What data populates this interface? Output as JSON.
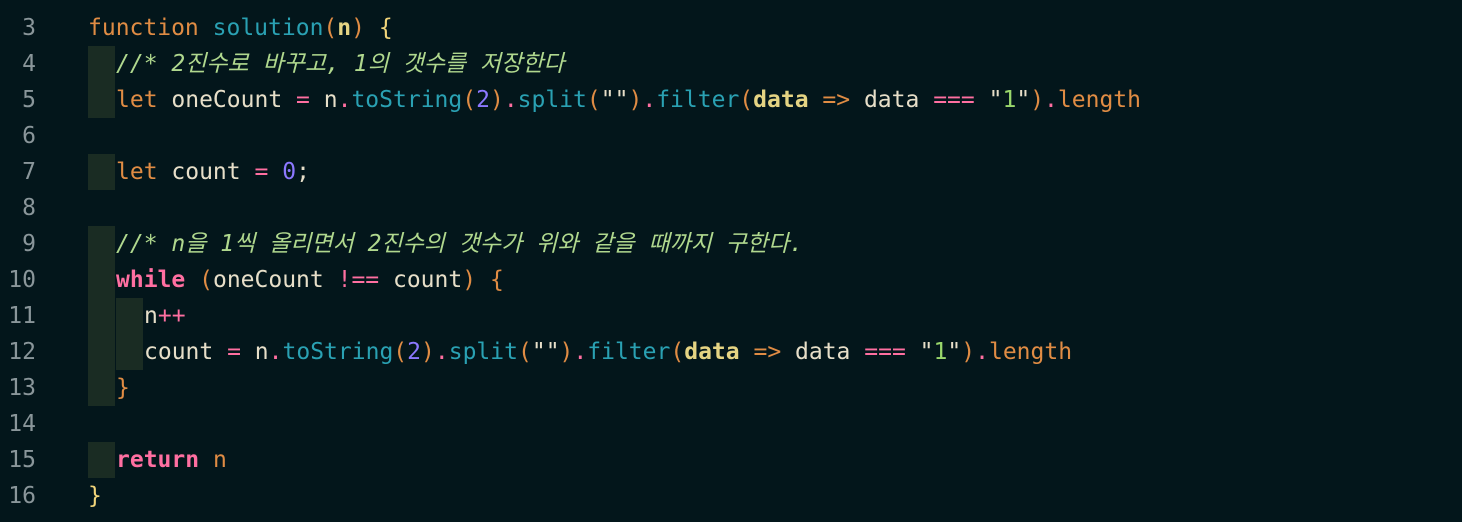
{
  "editor": {
    "colors": {
      "background": "#03161b",
      "line_number": "#8a969a",
      "keyword": "#e08c44",
      "function": "#2aa1b3",
      "comment": "#b0d88e",
      "operator": "#ff6fa1",
      "number": "#8c78ff",
      "string": "#9ad86c",
      "indent_guide": "#1a2c23"
    },
    "lines": [
      {
        "number": "3",
        "tokens": [
          {
            "t": "function",
            "c": "kw"
          },
          {
            "t": " ",
            "c": "plain"
          },
          {
            "t": "solution",
            "c": "fn"
          },
          {
            "t": "(",
            "c": "paren"
          },
          {
            "t": "n",
            "c": "param"
          },
          {
            "t": ")",
            "c": "paren"
          },
          {
            "t": " ",
            "c": "plain"
          },
          {
            "t": "{",
            "c": "brace"
          }
        ]
      },
      {
        "number": "4",
        "tokens": [
          {
            "t": "//* 2진수로 바꾸고, 1의 갯수를 저장한다",
            "c": "comment"
          }
        ]
      },
      {
        "number": "5",
        "tokens": [
          {
            "t": "let",
            "c": "kw"
          },
          {
            "t": " oneCount ",
            "c": "plain"
          },
          {
            "t": "=",
            "c": "op"
          },
          {
            "t": " n",
            "c": "plain"
          },
          {
            "t": ".",
            "c": "op"
          },
          {
            "t": "toString",
            "c": "method"
          },
          {
            "t": "(",
            "c": "paren"
          },
          {
            "t": "2",
            "c": "num"
          },
          {
            "t": ")",
            "c": "paren"
          },
          {
            "t": ".",
            "c": "op"
          },
          {
            "t": "split",
            "c": "method"
          },
          {
            "t": "(",
            "c": "paren"
          },
          {
            "t": "\"\"",
            "c": "plain"
          },
          {
            "t": ")",
            "c": "paren"
          },
          {
            "t": ".",
            "c": "op"
          },
          {
            "t": "filter",
            "c": "method"
          },
          {
            "t": "(",
            "c": "paren"
          },
          {
            "t": "data",
            "c": "param"
          },
          {
            "t": " ",
            "c": "plain"
          },
          {
            "t": "=>",
            "c": "kw"
          },
          {
            "t": " data ",
            "c": "plain"
          },
          {
            "t": "===",
            "c": "op"
          },
          {
            "t": " ",
            "c": "plain"
          },
          {
            "t": "\"",
            "c": "plain"
          },
          {
            "t": "1",
            "c": "str"
          },
          {
            "t": "\"",
            "c": "plain"
          },
          {
            "t": ")",
            "c": "paren"
          },
          {
            "t": ".",
            "c": "op"
          },
          {
            "t": "length",
            "c": "prop"
          }
        ]
      },
      {
        "number": "6",
        "tokens": []
      },
      {
        "number": "7",
        "tokens": [
          {
            "t": "let",
            "c": "kw"
          },
          {
            "t": " count ",
            "c": "plain"
          },
          {
            "t": "=",
            "c": "op"
          },
          {
            "t": " ",
            "c": "plain"
          },
          {
            "t": "0",
            "c": "num"
          },
          {
            "t": ";",
            "c": "plain"
          }
        ]
      },
      {
        "number": "8",
        "tokens": []
      },
      {
        "number": "9",
        "tokens": [
          {
            "t": "//* n을 1씩 올리면서 2진수의 갯수가 위와 같을 때까지 구한다.",
            "c": "comment"
          }
        ]
      },
      {
        "number": "10",
        "tokens": [
          {
            "t": "while",
            "c": "ctrl"
          },
          {
            "t": " ",
            "c": "plain"
          },
          {
            "t": "(",
            "c": "paren"
          },
          {
            "t": "oneCount ",
            "c": "plain"
          },
          {
            "t": "!==",
            "c": "op"
          },
          {
            "t": " count",
            "c": "plain"
          },
          {
            "t": ")",
            "c": "paren"
          },
          {
            "t": " ",
            "c": "plain"
          },
          {
            "t": "{",
            "c": "paren"
          }
        ]
      },
      {
        "number": "11",
        "tokens": [
          {
            "t": "n",
            "c": "plain"
          },
          {
            "t": "++",
            "c": "op"
          }
        ]
      },
      {
        "number": "12",
        "tokens": [
          {
            "t": "count ",
            "c": "plain"
          },
          {
            "t": "=",
            "c": "op"
          },
          {
            "t": " n",
            "c": "plain"
          },
          {
            "t": ".",
            "c": "op"
          },
          {
            "t": "toString",
            "c": "method"
          },
          {
            "t": "(",
            "c": "paren"
          },
          {
            "t": "2",
            "c": "num"
          },
          {
            "t": ")",
            "c": "paren"
          },
          {
            "t": ".",
            "c": "op"
          },
          {
            "t": "split",
            "c": "method"
          },
          {
            "t": "(",
            "c": "paren"
          },
          {
            "t": "\"\"",
            "c": "plain"
          },
          {
            "t": ")",
            "c": "paren"
          },
          {
            "t": ".",
            "c": "op"
          },
          {
            "t": "filter",
            "c": "method"
          },
          {
            "t": "(",
            "c": "paren"
          },
          {
            "t": "data",
            "c": "param"
          },
          {
            "t": " ",
            "c": "plain"
          },
          {
            "t": "=>",
            "c": "kw"
          },
          {
            "t": " data ",
            "c": "plain"
          },
          {
            "t": "===",
            "c": "op"
          },
          {
            "t": " ",
            "c": "plain"
          },
          {
            "t": "\"",
            "c": "plain"
          },
          {
            "t": "1",
            "c": "str"
          },
          {
            "t": "\"",
            "c": "plain"
          },
          {
            "t": ")",
            "c": "paren"
          },
          {
            "t": ".",
            "c": "op"
          },
          {
            "t": "length",
            "c": "prop"
          }
        ]
      },
      {
        "number": "13",
        "tokens": [
          {
            "t": "}",
            "c": "paren"
          }
        ]
      },
      {
        "number": "14",
        "tokens": []
      },
      {
        "number": "15",
        "tokens": [
          {
            "t": "return",
            "c": "ctrl"
          },
          {
            "t": " n",
            "c": "kw"
          }
        ]
      },
      {
        "number": "16",
        "tokens": [
          {
            "t": "}",
            "c": "brace"
          }
        ]
      }
    ]
  }
}
